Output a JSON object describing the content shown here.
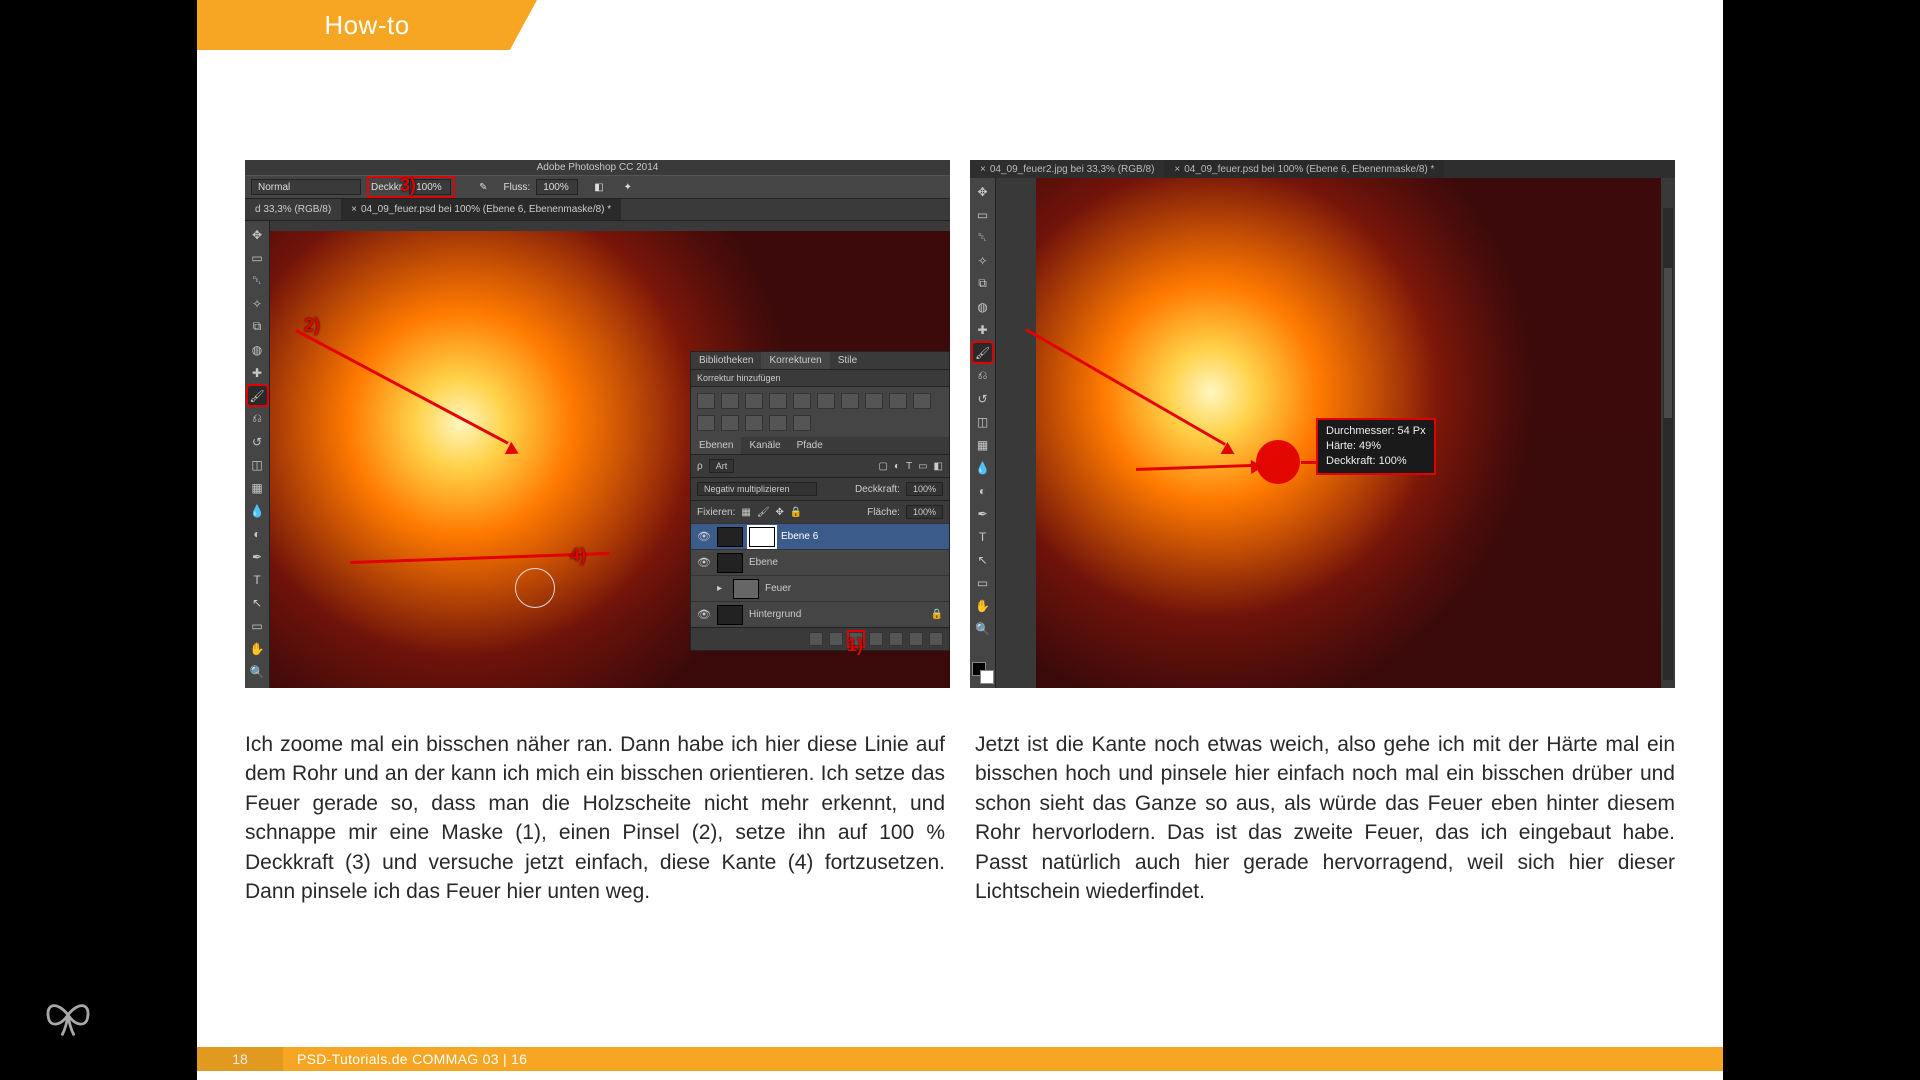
{
  "header": {
    "tab_label": "How-to"
  },
  "left_shot": {
    "app_title": "Adobe Photoshop CC 2014",
    "mode_label": "Normal",
    "opacity_label": "Deckkr.:",
    "opacity_value": "100%",
    "flow_label": "Fluss:",
    "flow_value": "100%",
    "doc_tab_1": "d 33,3% (RGB/8)",
    "doc_tab_2": "04_09_feuer.psd bei 100% (Ebene 6, Ebenenmaske/8) *",
    "markers": {
      "m1": "1)",
      "m2": "2)",
      "m3": "3)",
      "m4": "4)"
    },
    "panels": {
      "tabs": [
        "Bibliotheken",
        "Korrekturen",
        "Stile"
      ],
      "adjust_header": "Korrektur hinzufügen",
      "layer_tabs": [
        "Ebenen",
        "Kanäle",
        "Pfade"
      ],
      "kind_label": "Art",
      "blend_mode": "Negativ multiplizieren",
      "deckkraft_label": "Deckkraft:",
      "deckkraft_value": "100%",
      "fixieren_label": "Fixieren:",
      "flaeche_label": "Fläche:",
      "flaeche_value": "100%",
      "layers": [
        {
          "name": "Ebene 6"
        },
        {
          "name": "Ebene"
        },
        {
          "name": "Feuer"
        },
        {
          "name": "Hintergrund"
        }
      ]
    }
  },
  "right_shot": {
    "doc_tab_1": "04_09_feuer2.jpg bei 33,3% (RGB/8)",
    "doc_tab_2": "04_09_feuer.psd bei 100% (Ebene 6, Ebenenmaske/8) *",
    "hud_line1": "Durchmesser: 54 Px",
    "hud_line2": "Härte: 49%",
    "hud_line3": "Deckkraft: 100%"
  },
  "text": {
    "left": "Ich zoome mal ein bisschen näher ran. Dann habe ich hier diese Linie auf dem Rohr und an der kann ich mich ein bisschen orientieren. Ich setze das Feuer gerade so, dass man die Holzscheite nicht mehr erkennt, und schnappe mir eine Maske (1), einen Pinsel (2), setze ihn auf 100 % Deckkraft (3) und versuche jetzt einfach, diese Kante (4) fortzusetzen. Dann pinsele ich das Feuer hier unten weg.",
    "right": "Jetzt ist die Kante noch etwas weich, also gehe ich mit der Härte mal ein bisschen hoch und pinsele hier einfach noch mal ein bisschen drüber und schon sieht das Ganze so aus, als würde das Feuer eben hinter diesem Rohr hervorlodern. Das ist das zweite Feuer, das ich eingebaut habe. Passt natürlich auch hier gerade hervorragend, weil sich hier dieser Lichtschein wiederfindet."
  },
  "footer": {
    "page_number": "18",
    "credits": "PSD-Tutorials.de   COMMAG 03 | 16"
  }
}
